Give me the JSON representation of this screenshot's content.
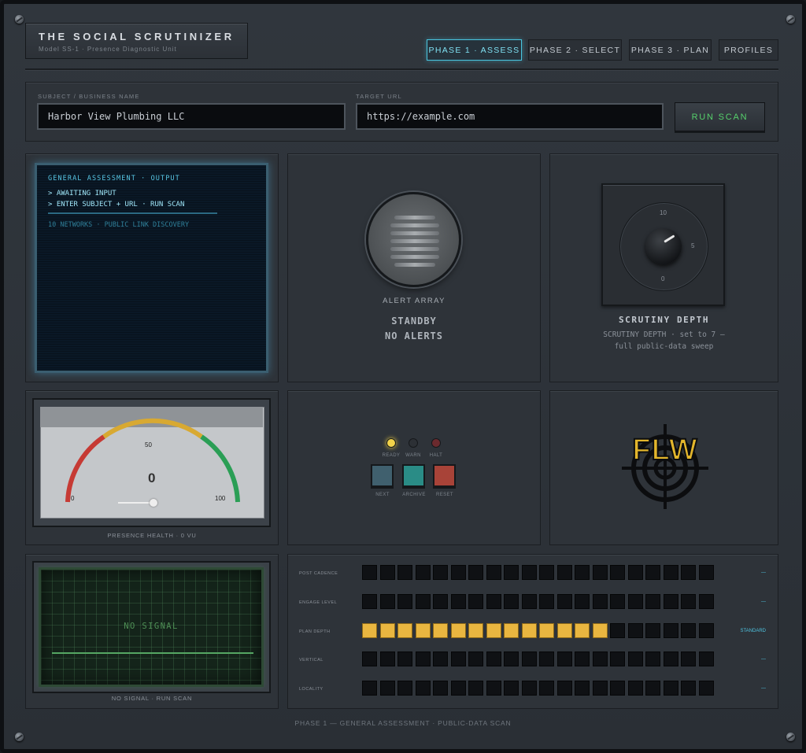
{
  "header": {
    "title": "THE SOCIAL SCRUTINIZER",
    "subtitle": "Model SS-1 · Presence Diagnostic Unit",
    "tabs": [
      {
        "label": "PHASE 1 · ASSESS",
        "active": true
      },
      {
        "label": "PHASE 2 · SELECT",
        "active": false
      },
      {
        "label": "PHASE 3 · PLAN",
        "active": false
      },
      {
        "label": "PROFILES",
        "active": false
      }
    ]
  },
  "inputs": {
    "subject_label": "SUBJECT / BUSINESS NAME",
    "subject_value": "Harbor View Plumbing LLC",
    "url_label": "TARGET URL",
    "url_value": "https://example.com",
    "run_label": "RUN SCAN"
  },
  "terminal": {
    "header": "GENERAL ASSESSMENT · OUTPUT",
    "line1": "> AWAITING INPUT",
    "line2": "> ENTER SUBJECT + URL · RUN SCAN",
    "line3": "10 NETWORKS · PUBLIC LINK DISCOVERY"
  },
  "alert": {
    "label": "ALERT ARRAY",
    "status1": "STANDBY",
    "status2": "NO ALERTS"
  },
  "depth": {
    "title": "SCRUTINY DEPTH",
    "desc1": "SCRUTINY DEPTH · set to 7 —",
    "desc2": "full public-data sweep",
    "dial_labels": {
      "top": "10",
      "right": "5",
      "bottom": "0"
    },
    "value": 7
  },
  "meter": {
    "ticks": {
      "min": "0",
      "mid": "50",
      "max": "100"
    },
    "reading": "0",
    "caption": "PRESENCE HEALTH · 0 VU"
  },
  "controls": {
    "leds": [
      {
        "label": "READY",
        "color": "#f2d34a",
        "on": true
      },
      {
        "label": "WARN",
        "color": "#2c3035",
        "on": false
      },
      {
        "label": "HALT",
        "color": "#6b2a2e",
        "on": false
      }
    ],
    "buttons": [
      {
        "label": "NEXT",
        "color": "#40606e"
      },
      {
        "label": "ARCHIVE",
        "color": "#2a8c86"
      },
      {
        "label": "RESET",
        "color": "#a84338"
      }
    ]
  },
  "logo": {
    "text": "FLW",
    "color": "#e3b62c"
  },
  "scope": {
    "center_text": "NO SIGNAL",
    "caption": "NO SIGNAL · RUN SCAN"
  },
  "bars": {
    "segments_total": 20,
    "rows": [
      {
        "label": "POST CADENCE",
        "lit": 0,
        "value": "—"
      },
      {
        "label": "ENGAGE LEVEL",
        "lit": 0,
        "value": "—"
      },
      {
        "label": "PLAN DEPTH",
        "lit": 14,
        "value": "STANDARD"
      },
      {
        "label": "VERTICAL",
        "lit": 0,
        "value": "—"
      },
      {
        "label": "LOCALITY",
        "lit": 0,
        "value": "—"
      }
    ]
  },
  "footer": "PHASE 1 — GENERAL ASSESSMENT · PUBLIC-DATA SCAN"
}
